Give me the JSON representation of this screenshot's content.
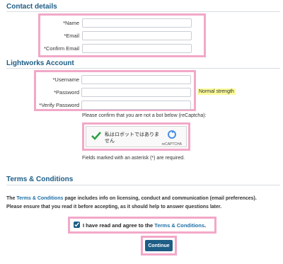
{
  "contact": {
    "title": "Contact details",
    "fields": [
      {
        "label": "*Name",
        "value": ""
      },
      {
        "label": "*Email",
        "value": ""
      },
      {
        "label": "*Confirm Email",
        "value": ""
      }
    ]
  },
  "account": {
    "title": "Lightworks Account",
    "fields": [
      {
        "label": "*Username",
        "value": ""
      },
      {
        "label": "*Password",
        "value": ""
      },
      {
        "label": "*Verify Password",
        "value": ""
      }
    ],
    "strength_badge": "Normal strength"
  },
  "captcha": {
    "prompt": "Please confirm that you are not a bot below (reCaptcha):",
    "text": "私はロボットではありません",
    "brand": "reCAPTCHA",
    "footnote": "Fields marked with an asterisk (*) are required."
  },
  "terms": {
    "title": "Terms & Conditions",
    "para_prefix": "The ",
    "para_link": "Terms & Conditions",
    "para_suffix": " page includes info on licensing, conduct and communication (email preferences).",
    "para_line2": "Please ensure that you read it before accepting, as it should help to answer questions later.",
    "agree_prefix": "I have read and agree to the ",
    "agree_link": "Terms & Conditions",
    "agree_suffix": ".",
    "agree_checked": true,
    "continue_label": "Continue"
  },
  "colors": {
    "accent": "#1d5d86",
    "link": "#1d6fa5",
    "highlight": "#f2a8c8",
    "strength": "#fbfb9a",
    "check_green": "#2f9e44"
  }
}
